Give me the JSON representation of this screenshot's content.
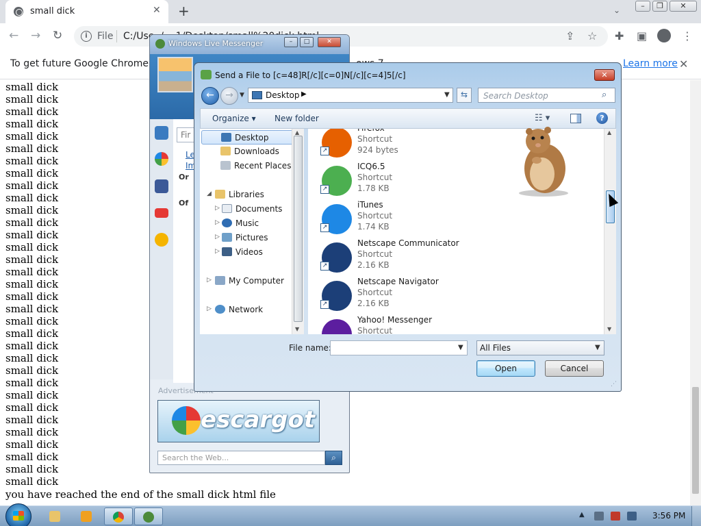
{
  "browser": {
    "tab_title": "small dick",
    "tab_close_icon": "close-icon",
    "new_tab_symbol": "+",
    "scheme": "File",
    "url": "C:/Use··/····1/Desktop/small%20dick.html",
    "infobar_text": "To get future Google Chrome updat",
    "infobar_text_tail": "ows 7",
    "infobar_learn_more": "Learn more",
    "infobar_close_symbol": "✕"
  },
  "page": {
    "line_text": "small dick",
    "line_count": 33,
    "end_text": "you have reached the end of the small dick html file"
  },
  "messenger": {
    "title": "Windows Live Messenger",
    "find_placeholder": "Fir",
    "info_link": "Le\nIm",
    "group_online": "Or",
    "group_offline": "Of",
    "ad_label": "Advertisement",
    "ad_brand": "escargot",
    "search_placeholder": "Search the Web..."
  },
  "dialog": {
    "title": "Send a File to [c=48]R[/c][c=0]N[/c][c=4]5[/c]",
    "close_symbol": "✕",
    "address": "Desktop",
    "address_sep": "▶",
    "search_placeholder": "Search Desktop",
    "organize_label": "Organize ▾",
    "new_folder_label": "New folder",
    "views_icon": "views-icon",
    "help_symbol": "?",
    "nav_items": [
      {
        "label": "Desktop"
      },
      {
        "label": "Downloads"
      },
      {
        "label": "Recent Places"
      },
      {
        "label": "Libraries"
      },
      {
        "label": "Documents"
      },
      {
        "label": "Music"
      },
      {
        "label": "Pictures"
      },
      {
        "label": "Videos"
      },
      {
        "label": "My Computer"
      },
      {
        "label": "Network"
      }
    ],
    "files": [
      {
        "name": "Firefox",
        "type": "Shortcut",
        "size": "924 bytes",
        "icon_color": "#e66000"
      },
      {
        "name": "ICQ6.5",
        "type": "Shortcut",
        "size": "1.78 KB",
        "icon_color": "#4caf50"
      },
      {
        "name": "iTunes",
        "type": "Shortcut",
        "size": "1.74 KB",
        "icon_color": "#1e88e5"
      },
      {
        "name": "Netscape Communicator",
        "type": "Shortcut",
        "size": "2.16 KB",
        "icon_color": "#1c3f78"
      },
      {
        "name": "Netscape Navigator",
        "type": "Shortcut",
        "size": "2.16 KB",
        "icon_color": "#1c3f78"
      },
      {
        "name": "Yahoo! Messenger",
        "type": "Shortcut",
        "size": "",
        "icon_color": "#5c1e9f"
      }
    ],
    "filename_label": "File name:",
    "filename_value": "",
    "filter_value": "All Files",
    "open_label": "Open",
    "cancel_label": "Cancel"
  },
  "taskbar": {
    "clock": "3:56 PM",
    "tray_up_symbol": "▲"
  },
  "colors": {
    "accent": "#1a73e8",
    "dialog_bg": "#d9e6f3",
    "taskbar": "#7d9ec0"
  }
}
